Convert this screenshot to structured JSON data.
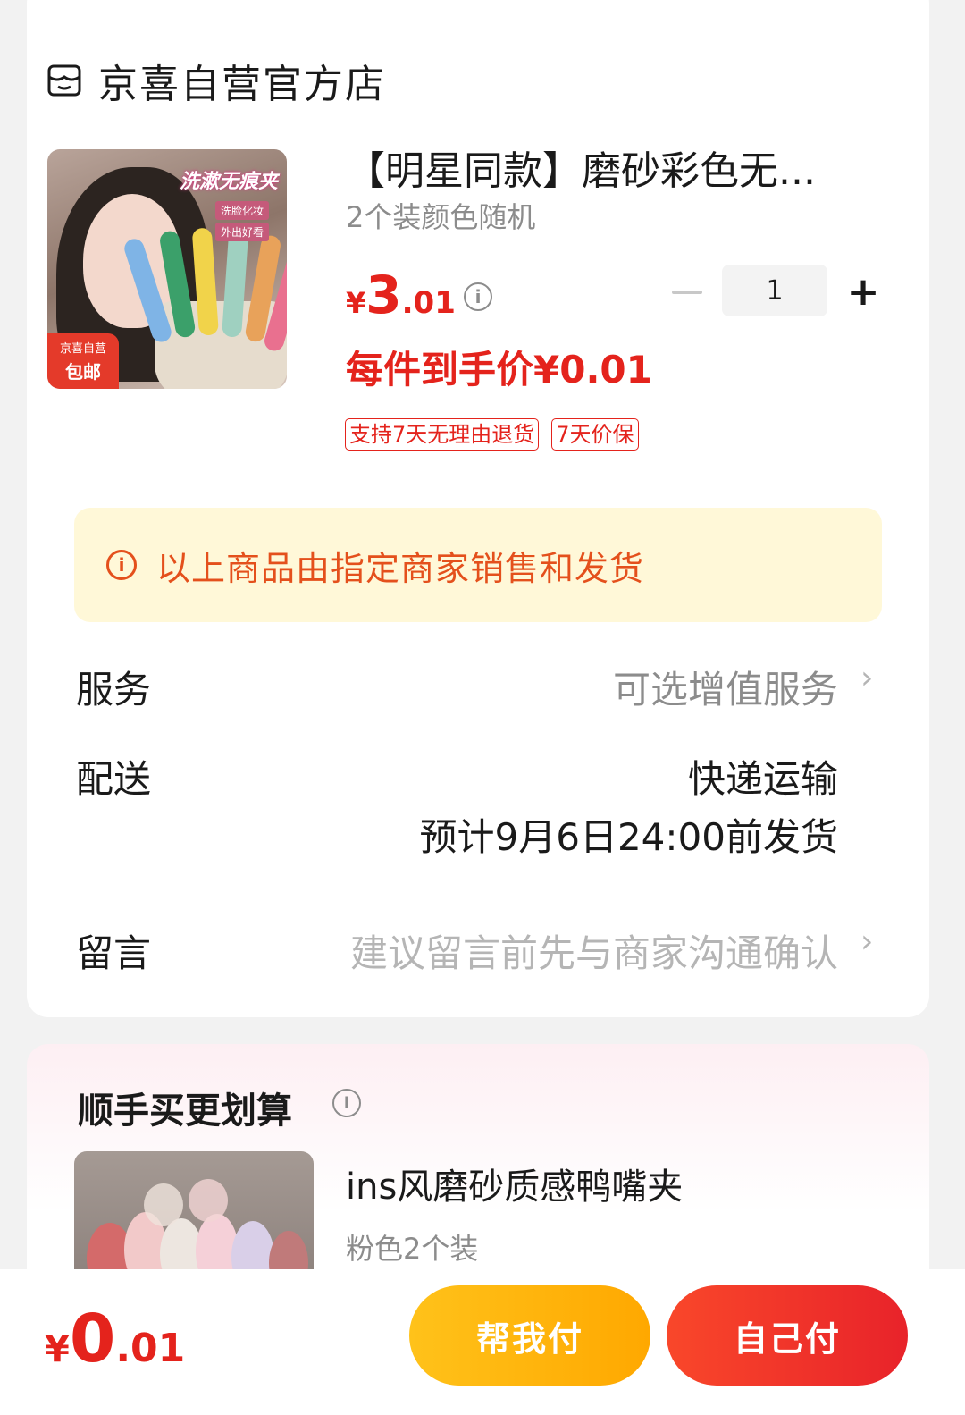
{
  "shop": {
    "name": "京喜自营官方店",
    "icon": "store-icon"
  },
  "product": {
    "image": {
      "overlay_title": "洗漱无痕夹",
      "chips": [
        "洗脸化妆",
        "外出好看"
      ],
      "badge_top": "京喜自营",
      "badge_bottom": "包邮"
    },
    "title": "【明星同款】磨砂彩色无...",
    "spec": "2个装颜色随机",
    "price": {
      "currency": "¥",
      "integer": "3",
      "decimal": ".01"
    },
    "quantity": "1",
    "stepper_minus": "−",
    "stepper_plus": "+",
    "final_price": "每件到手价¥0.01",
    "tags": [
      "支持7天无理由退货",
      "7天价保"
    ]
  },
  "notice": {
    "icon": "info-icon",
    "text": "以上商品由指定商家销售和发货"
  },
  "rows": {
    "service": {
      "label": "服务",
      "value": "可选增值服务"
    },
    "delivery": {
      "label": "配送",
      "method": "快递运输",
      "eta": "预计9月6日24:00前发货"
    },
    "message": {
      "label": "留言",
      "placeholder": "建议留言前先与商家沟通确认"
    }
  },
  "chevron": "›",
  "bundle": {
    "title": "顺手买更划算",
    "item": {
      "name": "ins风磨砂质感鸭嘴夹",
      "spec": "粉色2个装"
    }
  },
  "footer": {
    "total": {
      "currency": "¥",
      "integer": "0",
      "decimal": ".01"
    },
    "help_pay": "帮我付",
    "self_pay": "自己付"
  },
  "colors": {
    "accent": "#e4231c",
    "notice_bg": "#fff8d8",
    "help_btn": "#ffb30f",
    "self_btn": "#ef3529"
  }
}
